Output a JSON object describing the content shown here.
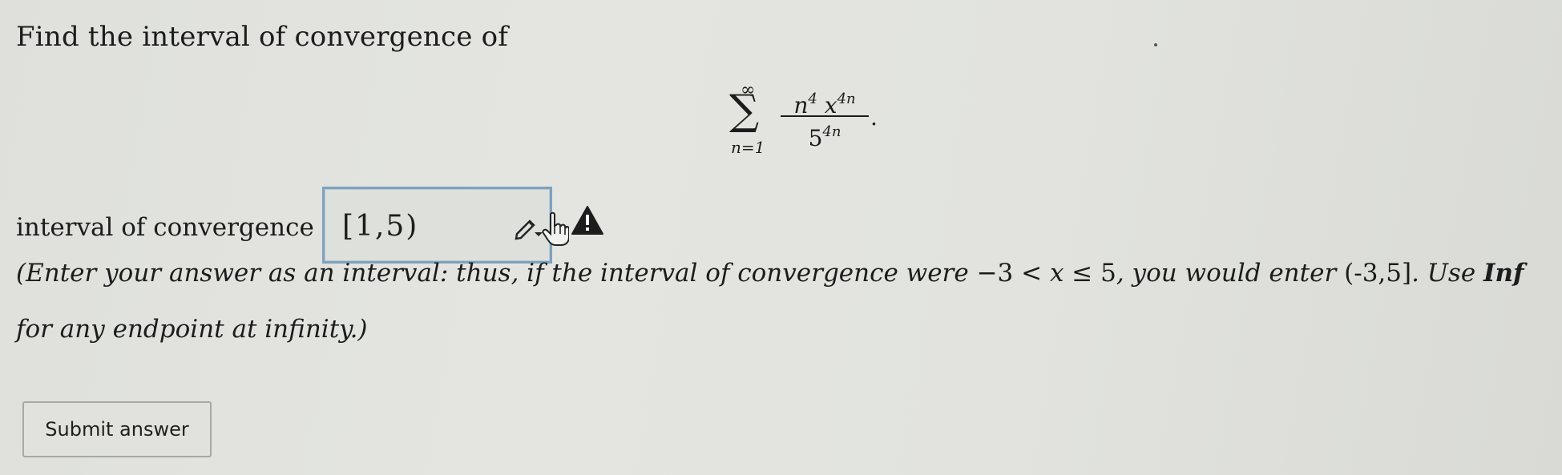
{
  "question": {
    "prompt": "Find the interval of convergence of",
    "series": {
      "sigma": "∑",
      "upper_limit": "∞",
      "lower_limit": "n=1",
      "numerator_base1": "n",
      "numerator_exp1": "4",
      "numerator_base2": "x",
      "numerator_exp2": "4n",
      "denominator_base": "5",
      "denominator_exp": "4n",
      "terminator": "."
    }
  },
  "answer": {
    "label": "interval of convergence =",
    "value": "[1,5)"
  },
  "icons": {
    "pencil": "pencil-icon",
    "hand_cursor": "hand-cursor-icon",
    "warning": "warning-icon"
  },
  "instructions": {
    "part1": "(Enter your answer as an interval: thus, if the interval of convergence were ",
    "math_a": "−3 < ",
    "math_var": "x",
    "math_b": " ≤ 5",
    "part2": ", you would enter ",
    "example": "(-3,5]",
    "part3": ". Use ",
    "keyword": "Inf",
    "part4": " for any endpoint at infinity.)"
  },
  "submit": {
    "label": "Submit answer"
  },
  "colors": {
    "background": "#e2e3df",
    "answer_border": "#7fa2bd",
    "warning": "#1c1c1c"
  }
}
